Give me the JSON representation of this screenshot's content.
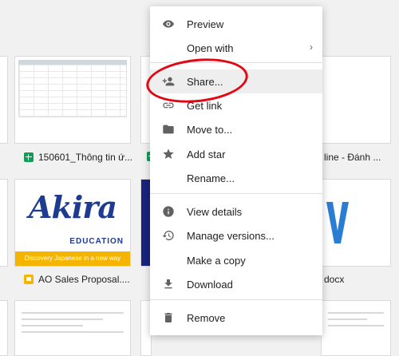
{
  "files": [
    {
      "name": "150601_Thông tin ứ...",
      "type": "sheets"
    },
    {
      "name": "line - Đánh ...",
      "type": "docs"
    },
    {
      "name": "AO Sales Proposal....",
      "type": "slides"
    },
    {
      "name": "docx",
      "type": "word"
    }
  ],
  "akira": {
    "logo": "Akira",
    "sub": "EDUCATION",
    "tagline": "Discovery Japanese in a new way"
  },
  "menu": {
    "items": [
      {
        "label": "Preview",
        "icon": "eye-icon"
      },
      {
        "label": "Open with",
        "icon": "",
        "submenu": true
      },
      {
        "label": "Share...",
        "icon": "person-add-icon",
        "active": true
      },
      {
        "label": "Get link",
        "icon": "link-icon"
      },
      {
        "label": "Move to...",
        "icon": "folder-icon"
      },
      {
        "label": "Add star",
        "icon": "star-icon"
      },
      {
        "label": "Rename...",
        "icon": ""
      },
      {
        "label": "View details",
        "icon": "info-icon"
      },
      {
        "label": "Manage versions...",
        "icon": "history-icon"
      },
      {
        "label": "Make a copy",
        "icon": ""
      },
      {
        "label": "Download",
        "icon": "download-icon"
      },
      {
        "label": "Remove",
        "icon": "trash-icon"
      }
    ]
  },
  "colors": {
    "highlight_circle": "#e30613",
    "sheets": "#0f9d58",
    "slides": "#f4b400",
    "word": "#2b7cd3"
  }
}
